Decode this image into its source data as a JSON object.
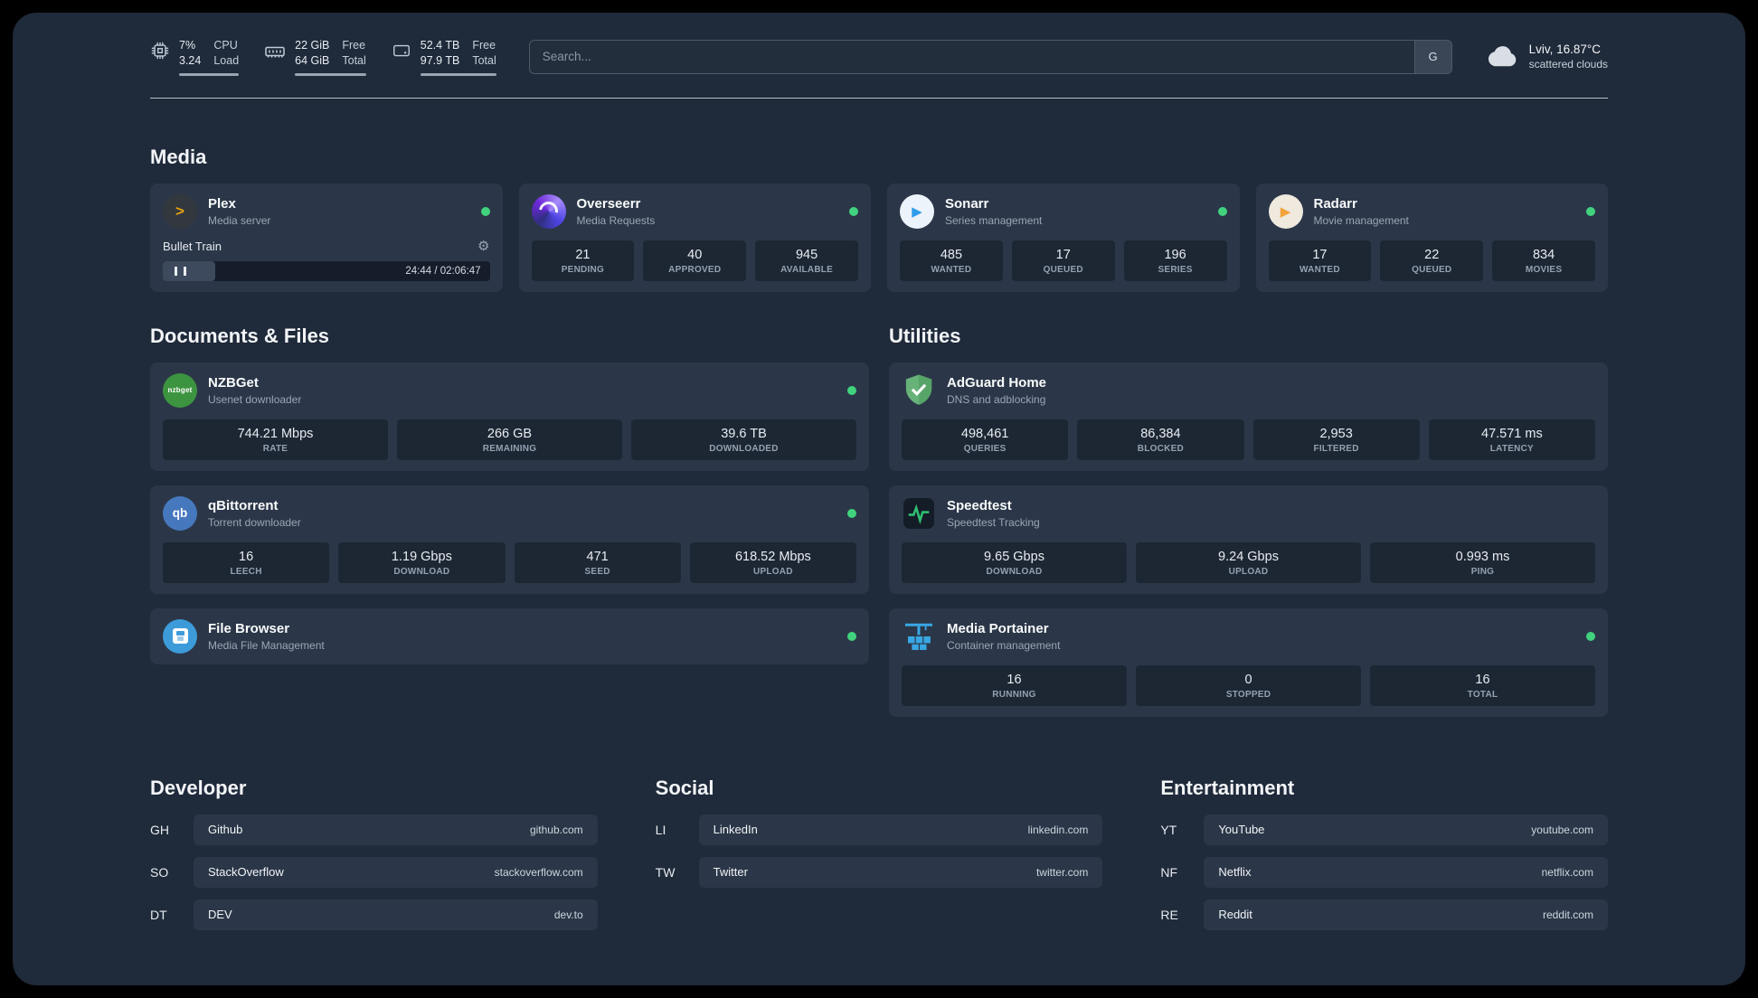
{
  "icons": {
    "plex_glyph": ">",
    "play_glyph": "▶",
    "gear_glyph": "⚙",
    "nzbget_text": "nzbget",
    "qb_text": "qb"
  },
  "topbar": {
    "cpu": {
      "value_top": "7%",
      "value_bottom": "3.24",
      "label_top": "CPU",
      "label_bottom": "Load"
    },
    "memory": {
      "value_top": "22 GiB",
      "value_bottom": "64 GiB",
      "label_top": "Free",
      "label_bottom": "Total"
    },
    "disk": {
      "value_top": "52.4 TB",
      "value_bottom": "97.9 TB",
      "label_top": "Free",
      "label_bottom": "Total"
    },
    "search": {
      "placeholder": "Search...",
      "button_label": "G"
    },
    "weather": {
      "location": "Lviv, 16.87°C",
      "condition": "scattered clouds"
    }
  },
  "sections": {
    "media": "Media",
    "documents": "Documents & Files",
    "utilities": "Utilities"
  },
  "services": {
    "plex": {
      "name": "Plex",
      "desc": "Media server",
      "now_playing": "Bullet Train",
      "time": "24:44 / 02:06:47"
    },
    "overseerr": {
      "name": "Overseerr",
      "desc": "Media Requests",
      "stats": [
        {
          "value": "21",
          "label": "PENDING"
        },
        {
          "value": "40",
          "label": "APPROVED"
        },
        {
          "value": "945",
          "label": "AVAILABLE"
        }
      ]
    },
    "sonarr": {
      "name": "Sonarr",
      "desc": "Series management",
      "stats": [
        {
          "value": "485",
          "label": "WANTED"
        },
        {
          "value": "17",
          "label": "QUEUED"
        },
        {
          "value": "196",
          "label": "SERIES"
        }
      ]
    },
    "radarr": {
      "name": "Radarr",
      "desc": "Movie management",
      "stats": [
        {
          "value": "17",
          "label": "WANTED"
        },
        {
          "value": "22",
          "label": "QUEUED"
        },
        {
          "value": "834",
          "label": "MOVIES"
        }
      ]
    },
    "nzbget": {
      "name": "NZBGet",
      "desc": "Usenet downloader",
      "stats": [
        {
          "value": "744.21 Mbps",
          "label": "RATE"
        },
        {
          "value": "266 GB",
          "label": "REMAINING"
        },
        {
          "value": "39.6 TB",
          "label": "DOWNLOADED"
        }
      ]
    },
    "qbittorrent": {
      "name": "qBittorrent",
      "desc": "Torrent downloader",
      "stats": [
        {
          "value": "16",
          "label": "LEECH"
        },
        {
          "value": "1.19 Gbps",
          "label": "DOWNLOAD"
        },
        {
          "value": "471",
          "label": "SEED"
        },
        {
          "value": "618.52 Mbps",
          "label": "UPLOAD"
        }
      ]
    },
    "filebrowser": {
      "name": "File Browser",
      "desc": "Media File Management"
    },
    "adguard": {
      "name": "AdGuard Home",
      "desc": "DNS and adblocking",
      "stats": [
        {
          "value": "498,461",
          "label": "QUERIES"
        },
        {
          "value": "86,384",
          "label": "BLOCKED"
        },
        {
          "value": "2,953",
          "label": "FILTERED"
        },
        {
          "value": "47.571 ms",
          "label": "LATENCY"
        }
      ]
    },
    "speedtest": {
      "name": "Speedtest",
      "desc": "Speedtest Tracking",
      "stats": [
        {
          "value": "9.65 Gbps",
          "label": "DOWNLOAD"
        },
        {
          "value": "9.24 Gbps",
          "label": "UPLOAD"
        },
        {
          "value": "0.993 ms",
          "label": "PING"
        }
      ]
    },
    "portainer": {
      "name": "Media Portainer",
      "desc": "Container management",
      "stats": [
        {
          "value": "16",
          "label": "RUNNING"
        },
        {
          "value": "0",
          "label": "STOPPED"
        },
        {
          "value": "16",
          "label": "TOTAL"
        }
      ]
    }
  },
  "bookmarks": {
    "developer": {
      "title": "Developer",
      "items": [
        {
          "abbr": "GH",
          "name": "Github",
          "url": "github.com"
        },
        {
          "abbr": "SO",
          "name": "StackOverflow",
          "url": "stackoverflow.com"
        },
        {
          "abbr": "DT",
          "name": "DEV",
          "url": "dev.to"
        }
      ]
    },
    "social": {
      "title": "Social",
      "items": [
        {
          "abbr": "LI",
          "name": "LinkedIn",
          "url": "linkedin.com"
        },
        {
          "abbr": "TW",
          "name": "Twitter",
          "url": "twitter.com"
        }
      ]
    },
    "entertainment": {
      "title": "Entertainment",
      "items": [
        {
          "abbr": "YT",
          "name": "YouTube",
          "url": "youtube.com"
        },
        {
          "abbr": "NF",
          "name": "Netflix",
          "url": "netflix.com"
        },
        {
          "abbr": "RE",
          "name": "Reddit",
          "url": "reddit.com"
        }
      ]
    }
  }
}
